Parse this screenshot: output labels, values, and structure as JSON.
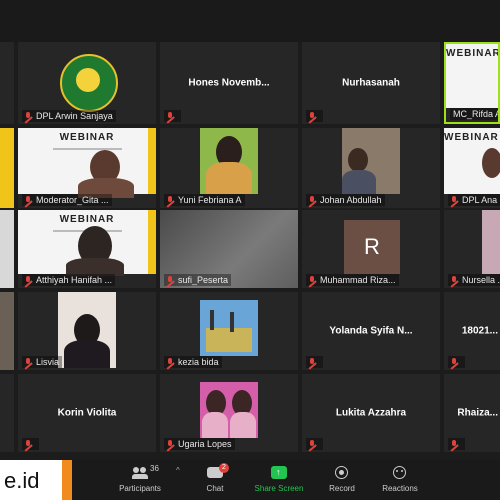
{
  "participants": [
    {
      "id": "dpl-arwin",
      "name": "DPL Arwin Sanjaya",
      "muted": true
    },
    {
      "id": "hones",
      "name": "Hones  Novemb...",
      "muted": true
    },
    {
      "id": "nurhasanah",
      "name": "Nurhasanah",
      "muted": true
    },
    {
      "id": "mc-rifda",
      "name": "MC_Rifda Ali...",
      "muted": false
    },
    {
      "id": "moderator-gita",
      "name": "Moderator_Gita ...",
      "muted": true
    },
    {
      "id": "yuni",
      "name": "Yuni Febriana A",
      "muted": true
    },
    {
      "id": "johan",
      "name": "Johan Abdullah",
      "muted": true
    },
    {
      "id": "dpl-ana",
      "name": "DPL Ana I...",
      "muted": true
    },
    {
      "id": "atthiyah",
      "name": "Atthiyah Hanifah ...",
      "muted": true
    },
    {
      "id": "sufi",
      "name": "sufi_Peserta",
      "muted": true
    },
    {
      "id": "muhammad-riza",
      "name": "Muhammad Riza...",
      "muted": true
    },
    {
      "id": "nursella",
      "name": "Nursella ...",
      "muted": true
    },
    {
      "id": "lisvia",
      "name": "Lisvia",
      "muted": true
    },
    {
      "id": "kezia",
      "name": "kezia bida",
      "muted": true
    },
    {
      "id": "yolanda",
      "name": "Yolanda  Syifa  N...",
      "muted": true
    },
    {
      "id": "id-18021",
      "name": "18021...",
      "muted": true
    },
    {
      "id": "korin",
      "name": "Korin Violita",
      "muted": true
    },
    {
      "id": "ugaria",
      "name": "Ugaria Lopes",
      "muted": true
    },
    {
      "id": "lukita",
      "name": "Lukita Azzahra",
      "muted": true
    },
    {
      "id": "rhaiza",
      "name": "Rhaiza...",
      "muted": true
    }
  ],
  "avatar_letter": "R",
  "webinar_title": "WEBINAR",
  "brand_text": "e.id",
  "toolbar": {
    "participants_count": "36",
    "chat_badge": "2",
    "participants_label": "Participants",
    "chat_label": "Chat",
    "share_label": "Share Screen",
    "record_label": "Record",
    "reactions_label": "Reactions"
  },
  "colors": {
    "accent_green": "#23c552",
    "mute_red": "#e0413a",
    "brand_orange": "#f28b1e"
  }
}
